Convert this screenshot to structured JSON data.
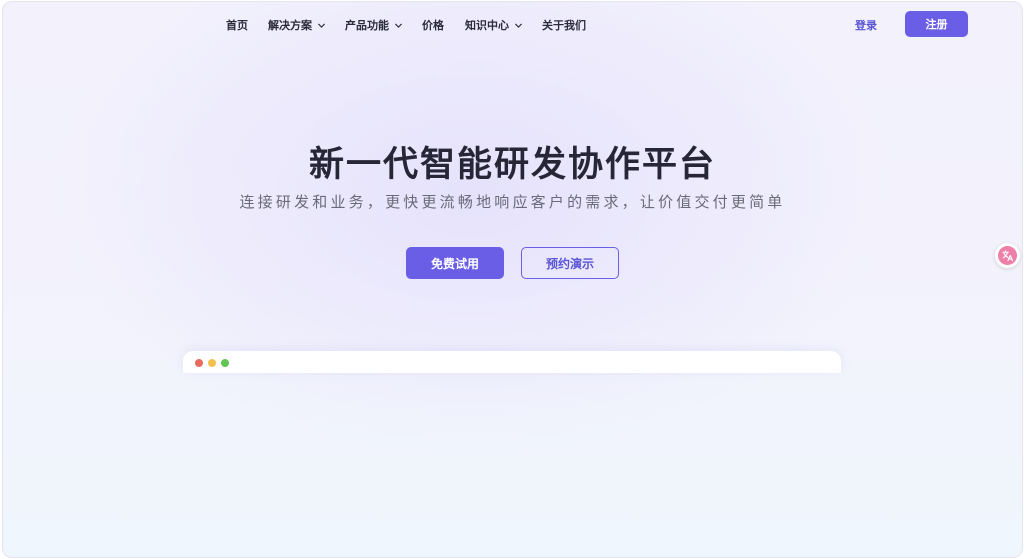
{
  "nav": {
    "items": [
      {
        "label": "首页",
        "has_dropdown": false
      },
      {
        "label": "解决方案",
        "has_dropdown": true
      },
      {
        "label": "产品功能",
        "has_dropdown": true
      },
      {
        "label": "价格",
        "has_dropdown": false
      },
      {
        "label": "知识中心",
        "has_dropdown": true
      },
      {
        "label": "关于我们",
        "has_dropdown": false
      }
    ],
    "login_label": "登录",
    "register_label": "注册"
  },
  "hero": {
    "title": "新一代智能研发协作平台",
    "subtitle": "连接研发和业务，更快更流畅地响应客户的需求，让价值交付更简单",
    "primary_cta": "免费试用",
    "secondary_cta": "预约演示"
  },
  "preview_window": {
    "controls": [
      "close-dot",
      "minimize-dot",
      "maximize-dot"
    ]
  },
  "floating_button": {
    "icon": "translate-icon"
  },
  "colors": {
    "accent": "#6a5ee6",
    "title": "#262636",
    "dot_red": "#ec6a5e",
    "dot_yellow": "#f4bf4f",
    "dot_green": "#61c554",
    "fab": "#ee7fa8"
  }
}
